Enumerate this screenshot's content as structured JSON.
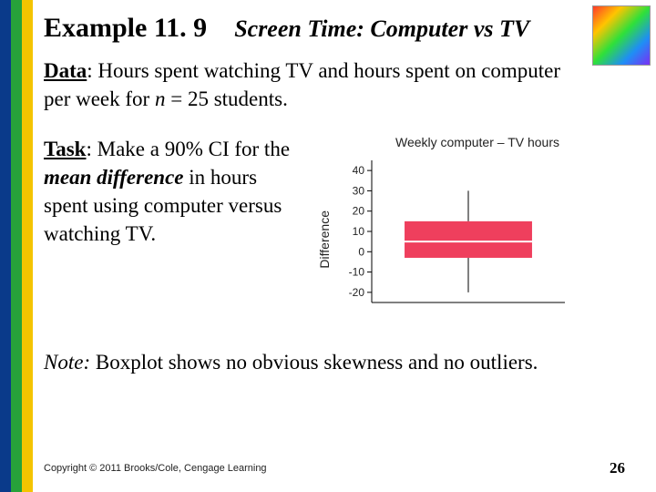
{
  "title": {
    "prefix": "Example 11. 9",
    "subtitle": "Screen Time: Computer vs TV"
  },
  "data_line": {
    "label": "Data",
    "text_a": ": Hours spent watching TV and hours spent on computer per week for ",
    "n_expr": "n",
    "text_b": " = 25 students."
  },
  "task": {
    "label": "Task",
    "text_a": ": Make a 90% CI for the ",
    "emph": "mean difference",
    "text_b": " in hours spent using computer versus watching TV."
  },
  "note": {
    "ital": "Note:",
    "text": " Boxplot shows no obvious skewness and no outliers."
  },
  "footer": {
    "copyright": "Copyright © 2011 Brooks/Cole, Cengage Learning",
    "page": "26"
  },
  "chart_data": {
    "type": "boxplot",
    "title": "Weekly computer – TV hours",
    "ylabel": "Difference",
    "ylim": [
      -25,
      45
    ],
    "yticks": [
      -20,
      -10,
      0,
      10,
      20,
      30,
      40
    ],
    "box": {
      "q1": -3,
      "median": 5,
      "q3": 15,
      "whisker_low": -20,
      "whisker_high": 30
    },
    "box_color": "#ef3f5d"
  }
}
